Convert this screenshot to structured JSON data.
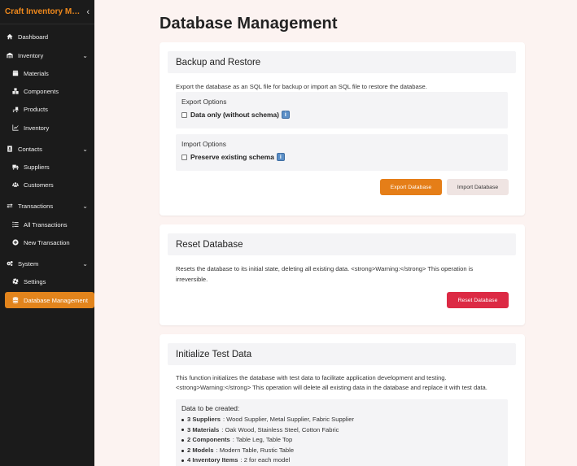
{
  "app": {
    "title": "Craft Inventory Management",
    "title_display": "Craft Inventory Man...",
    "collapse_icon": "chevron-left-icon"
  },
  "sidebar": {
    "items": [
      {
        "label": "Dashboard",
        "icon": "home-icon"
      },
      {
        "label": "Inventory",
        "icon": "warehouse-icon",
        "group": true
      },
      {
        "label": "Materials",
        "icon": "box-icon"
      },
      {
        "label": "Components",
        "icon": "cubes-icon"
      },
      {
        "label": "Products",
        "icon": "dolly-icon"
      },
      {
        "label": "Inventory",
        "icon": "chart-icon"
      },
      {
        "label": "Contacts",
        "icon": "address-book-icon",
        "group": true
      },
      {
        "label": "Suppliers",
        "icon": "truck-icon"
      },
      {
        "label": "Customers",
        "icon": "users-icon"
      },
      {
        "label": "Transactions",
        "icon": "exchange-icon",
        "group": true
      },
      {
        "label": "All Transactions",
        "icon": "list-icon"
      },
      {
        "label": "New Transaction",
        "icon": "plus-circle-icon"
      },
      {
        "label": "System",
        "icon": "cogs-icon",
        "group": true
      },
      {
        "label": "Settings",
        "icon": "gear-icon"
      },
      {
        "label": "Database Management",
        "icon": "database-icon",
        "active": true
      }
    ]
  },
  "page": {
    "title": "Database Management"
  },
  "backup": {
    "header": "Backup and Restore",
    "description": "Export the database as an SQL file for backup or import an SQL file to restore the database.",
    "export_options_title": "Export Options",
    "export_checkbox_label": "Data only (without schema)",
    "import_options_title": "Import Options",
    "import_checkbox_label": "Preserve existing schema",
    "info_glyph": "i",
    "export_button": "Export Database",
    "import_button": "Import Database"
  },
  "reset": {
    "header": "Reset Database",
    "description_line1": "Resets the database to its initial state, deleting all existing data. <strong>Warning:</strong> This operation is",
    "description_line2": "irreversible.",
    "button": "Reset Database"
  },
  "init": {
    "header": "Initialize Test Data",
    "description_line1": "This function initializes the database with test data to facilitate application development and testing.",
    "description_line2": "<strong>Warning:</strong> This operation will delete all existing data in the database and replace it with test data.",
    "list_title": "Data to be created:",
    "items": [
      {
        "bold": "3 Suppliers",
        "text": ": Wood Supplier, Metal Supplier, Fabric Supplier"
      },
      {
        "bold": "3 Materials",
        "text": ": Oak Wood, Stainless Steel, Cotton Fabric"
      },
      {
        "bold": "2 Components",
        "text": ": Table Leg, Table Top"
      },
      {
        "bold": "2 Models",
        "text": ": Modern Table, Rustic Table"
      },
      {
        "bold": "4 Inventory Items",
        "text": ": 2 for each model"
      }
    ]
  },
  "colors": {
    "accent": "#e57e18",
    "danger": "#dc2a44",
    "sidebar_bg": "#1b1b1b",
    "page_bg": "#fcf3f1"
  }
}
